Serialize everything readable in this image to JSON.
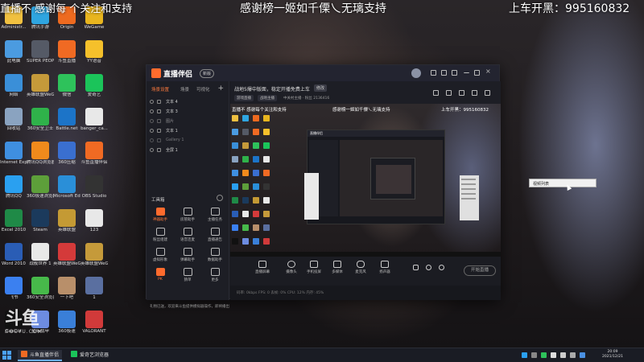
{
  "overlay": {
    "left": "直播不   感谢每   个关注和支持",
    "center": "感谢榜一姬如千傈乀无璃支持",
    "right": "上车开黑：995160832"
  },
  "desktop_icons": [
    {
      "label": "Administr...",
      "color": "#f0c040"
    },
    {
      "label": "腾讯手游",
      "color": "#2fa5e0"
    },
    {
      "label": "Origin",
      "color": "#ee6a1f"
    },
    {
      "label": "WeGame",
      "color": "#e8b51f"
    },
    {
      "label": "此电脑",
      "color": "#4b9be0"
    },
    {
      "label": "SUPER PEOPLE CBT",
      "color": "#555a66"
    },
    {
      "label": "斗鱼直播",
      "color": "#f06a23"
    },
    {
      "label": "YY语音",
      "color": "#f5c02b"
    },
    {
      "label": "网络",
      "color": "#3a8fd8"
    },
    {
      "label": "英雄联盟WeGame版",
      "color": "#c59a3a"
    },
    {
      "label": "微信",
      "color": "#2ec25b"
    },
    {
      "label": "爱奇艺",
      "color": "#1bc45a"
    },
    {
      "label": "回收站",
      "color": "#8aa3c0"
    },
    {
      "label": "360安全卫士",
      "color": "#2fb24a"
    },
    {
      "label": "Battle.net",
      "color": "#1c74c8"
    },
    {
      "label": "banger_ca...",
      "color": "#e8e8e8"
    },
    {
      "label": "Internet Explorer",
      "color": "#3f8fe0"
    },
    {
      "label": "腾讯QQ浏览器",
      "color": "#f08a1c"
    },
    {
      "label": "360压缩",
      "color": "#3a6fd0"
    },
    {
      "label": "斗鱼直播伴侣",
      "color": "#f06a23"
    },
    {
      "label": "腾讯QQ",
      "color": "#2aa0f0"
    },
    {
      "label": "360极速浏览器",
      "color": "#5d9f3a"
    },
    {
      "label": "Microsoft Edge",
      "color": "#2a8fd8"
    },
    {
      "label": "OBS Studio",
      "color": "#333"
    },
    {
      "label": "Excel 2010",
      "color": "#1f8a47"
    },
    {
      "label": "Steam",
      "color": "#1b3a5c"
    },
    {
      "label": "英雄联盟",
      "color": "#c49a34"
    },
    {
      "label": "123",
      "color": "#e8e8e8"
    },
    {
      "label": "Word 2010",
      "color": "#2a5db5"
    },
    {
      "label": "战舰世界 1",
      "color": "#e8e8e8"
    },
    {
      "label": "英雄联盟WeGame版",
      "color": "#d43a3a"
    },
    {
      "label": "英雄联盟WeGame版",
      "color": "#c59a3a"
    },
    {
      "label": "飞书",
      "color": "#3b80f0"
    },
    {
      "label": "360安全浏览器",
      "color": "#47b94a"
    },
    {
      "label": "一下吧",
      "color": "#b88f6a"
    },
    {
      "label": "1",
      "color": "#5a6fa0"
    },
    {
      "label": "CapCut",
      "color": "#111"
    },
    {
      "label": "星际战甲",
      "color": "#6d8ce0"
    },
    {
      "label": "360极速",
      "color": "#3a7fd8"
    },
    {
      "label": "VALORANT",
      "color": "#d13a3a"
    }
  ],
  "app": {
    "title": "直播伴侣",
    "version_badge": "新版",
    "left_tabs": [
      "场景设置",
      "场景",
      "可视化"
    ],
    "scenes": [
      "文本 4",
      "文本 3",
      "图片",
      "文本 1",
      "Gallery 1",
      "全屏 1"
    ],
    "toolbox_title": "工具箱",
    "tools": [
      "神器助手",
      "房管助手",
      "主播任务",
      "粉丝组建",
      "语音连麦",
      "直播通告",
      "虚拟形象",
      "弹幕助手",
      "数据助手",
      "PK",
      "猜单",
      "更多"
    ],
    "status_text": "礼物已送，欢迎来斗鱼提供模拟器操作，即将播出",
    "announcement": "战地5爆中版面，稳定开播免费上车",
    "edit_label": "修改",
    "chips": [
      "游戏直播",
      "战地主播"
    ],
    "info_text": "中关村主播 · 粉丝 2136416",
    "preview_texts": [
      "直播不   感谢每个关注和支持",
      "感谢榜一姬如千傈乀无璃支持",
      "上车开黑：995160832"
    ],
    "controls": [
      "直播屏幕",
      "摄像头",
      "手机投屏",
      "多媒体",
      "麦克风",
      "扬声器"
    ],
    "start_live": "开始直播",
    "stats": "码率: 0kbps   FPS: 0   丢帧: 0%   CPU: 12%   内存: 45%"
  },
  "tooltip_text": "视频列表",
  "watermark": {
    "big": "斗鱼",
    "small": "DOUYU.COM"
  },
  "taskbar": {
    "items": [
      "斗鱼直播伴侣",
      "爱奇艺浏览器"
    ],
    "clock_time": "20:09",
    "clock_date": "2021/12/21"
  }
}
